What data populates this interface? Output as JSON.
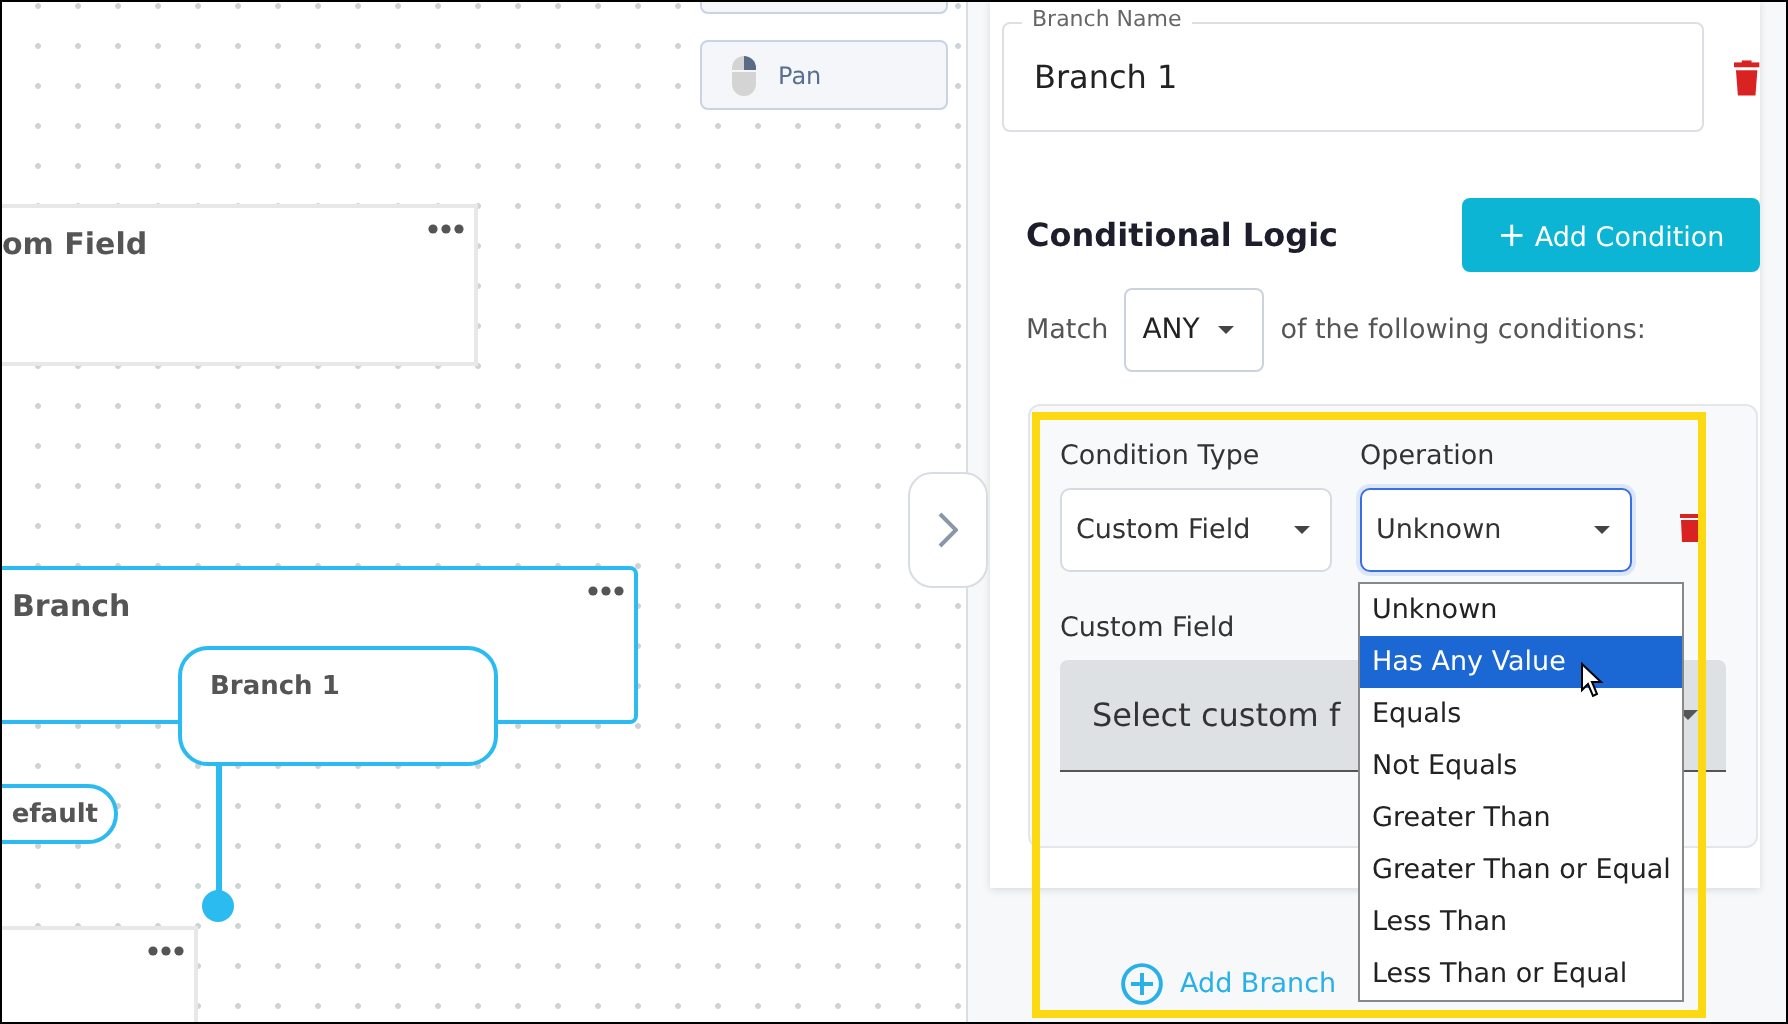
{
  "canvas": {
    "toolbar": [
      {
        "label": "Pan"
      }
    ],
    "nodes": [
      {
        "title": "om Field",
        "selected": false
      },
      {
        "title": "Branch",
        "selected": true
      },
      {
        "selected": false
      }
    ],
    "branch_pills": [
      {
        "label": "Branch 1",
        "selected": true
      },
      {
        "label": "efault",
        "selected": true
      }
    ]
  },
  "panel": {
    "branch_name": {
      "label": "Branch Name",
      "value": "Branch 1"
    },
    "section_title": "Conditional Logic",
    "add_condition_button": {
      "icon": "+",
      "label": "Add Condition"
    },
    "match": {
      "label": "Match",
      "value": "ANY",
      "suffix": "of the following conditions:"
    },
    "condition": {
      "condition_type": {
        "label": "Condition Type",
        "value": "Custom Field"
      },
      "operation": {
        "label": "Operation",
        "value": "Unknown",
        "expanded": true
      },
      "custom_field": {
        "label": "Custom Field",
        "placeholder": "Select custom f"
      }
    },
    "operation_options": [
      {
        "label": "Unknown",
        "selected": false
      },
      {
        "label": "Has Any Value",
        "selected": true
      },
      {
        "label": "Equals",
        "selected": false
      },
      {
        "label": "Not Equals",
        "selected": false
      },
      {
        "label": "Greater Than",
        "selected": false
      },
      {
        "label": "Greater Than or Equal",
        "selected": false
      },
      {
        "label": "Less Than",
        "selected": false
      },
      {
        "label": "Less Than or Equal",
        "selected": false
      }
    ],
    "add_branch_button": {
      "label": "Add Branch"
    }
  }
}
